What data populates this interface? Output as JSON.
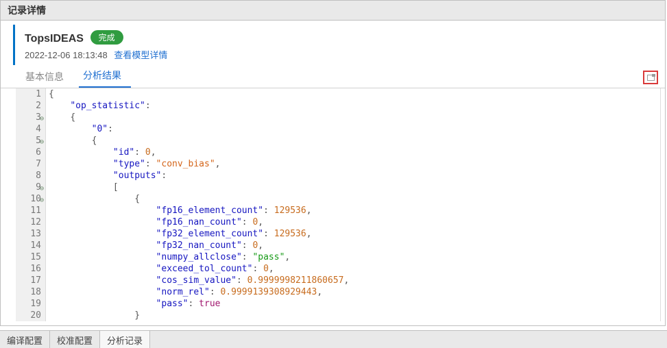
{
  "header": {
    "title": "记录详情"
  },
  "record": {
    "name": "TopsIDEAS",
    "status_label": "完成",
    "timestamp": "2022-12-06 18:13:48",
    "detail_link": "查看模型详情"
  },
  "tabs": {
    "basic": "基本信息",
    "result": "分析结果"
  },
  "bottom_tabs": {
    "compile": "编译配置",
    "calib": "校准配置",
    "analyze": "分析记录"
  },
  "code": {
    "fold_lines": [
      3,
      5,
      9,
      10
    ],
    "lines": [
      {
        "no": 1,
        "indent": 0,
        "kind": "brace",
        "text": "{"
      },
      {
        "no": 2,
        "indent": 1,
        "kind": "key",
        "key": "op_statistic",
        "tail": ":"
      },
      {
        "no": 3,
        "indent": 1,
        "kind": "brace",
        "text": "{"
      },
      {
        "no": 4,
        "indent": 2,
        "kind": "key",
        "key": "0",
        "tail": ":"
      },
      {
        "no": 5,
        "indent": 2,
        "kind": "brace",
        "text": "{"
      },
      {
        "no": 6,
        "indent": 3,
        "kind": "kv",
        "key": "id",
        "vtype": "int",
        "value": "0",
        "tail": ","
      },
      {
        "no": 7,
        "indent": 3,
        "kind": "kv",
        "key": "type",
        "vtype": "str",
        "value": "conv_bias",
        "tail": ","
      },
      {
        "no": 8,
        "indent": 3,
        "kind": "key",
        "key": "outputs",
        "tail": ":"
      },
      {
        "no": 9,
        "indent": 3,
        "kind": "brace",
        "text": "["
      },
      {
        "no": 10,
        "indent": 4,
        "kind": "brace",
        "text": "{"
      },
      {
        "no": 11,
        "indent": 5,
        "kind": "kv",
        "key": "fp16_element_count",
        "vtype": "int",
        "value": "129536",
        "tail": ","
      },
      {
        "no": 12,
        "indent": 5,
        "kind": "kv",
        "key": "fp16_nan_count",
        "vtype": "int",
        "value": "0",
        "tail": ","
      },
      {
        "no": 13,
        "indent": 5,
        "kind": "kv",
        "key": "fp32_element_count",
        "vtype": "int",
        "value": "129536",
        "tail": ","
      },
      {
        "no": 14,
        "indent": 5,
        "kind": "kv",
        "key": "fp32_nan_count",
        "vtype": "int",
        "value": "0",
        "tail": ","
      },
      {
        "no": 15,
        "indent": 5,
        "kind": "kv",
        "key": "numpy_allclose",
        "vtype": "pass",
        "value": "pass",
        "tail": ","
      },
      {
        "no": 16,
        "indent": 5,
        "kind": "kv",
        "key": "exceed_tol_count",
        "vtype": "int",
        "value": "0",
        "tail": ","
      },
      {
        "no": 17,
        "indent": 5,
        "kind": "kv",
        "key": "cos_sim_value",
        "vtype": "float",
        "value": "0.9999998211860657",
        "tail": ","
      },
      {
        "no": 18,
        "indent": 5,
        "kind": "kv",
        "key": "norm_rel",
        "vtype": "float",
        "value": "0.9999139308929443",
        "tail": ","
      },
      {
        "no": 19,
        "indent": 5,
        "kind": "kv",
        "key": "pass",
        "vtype": "bool",
        "value": "true",
        "tail": ""
      },
      {
        "no": 20,
        "indent": 4,
        "kind": "brace",
        "text": "}"
      }
    ]
  }
}
